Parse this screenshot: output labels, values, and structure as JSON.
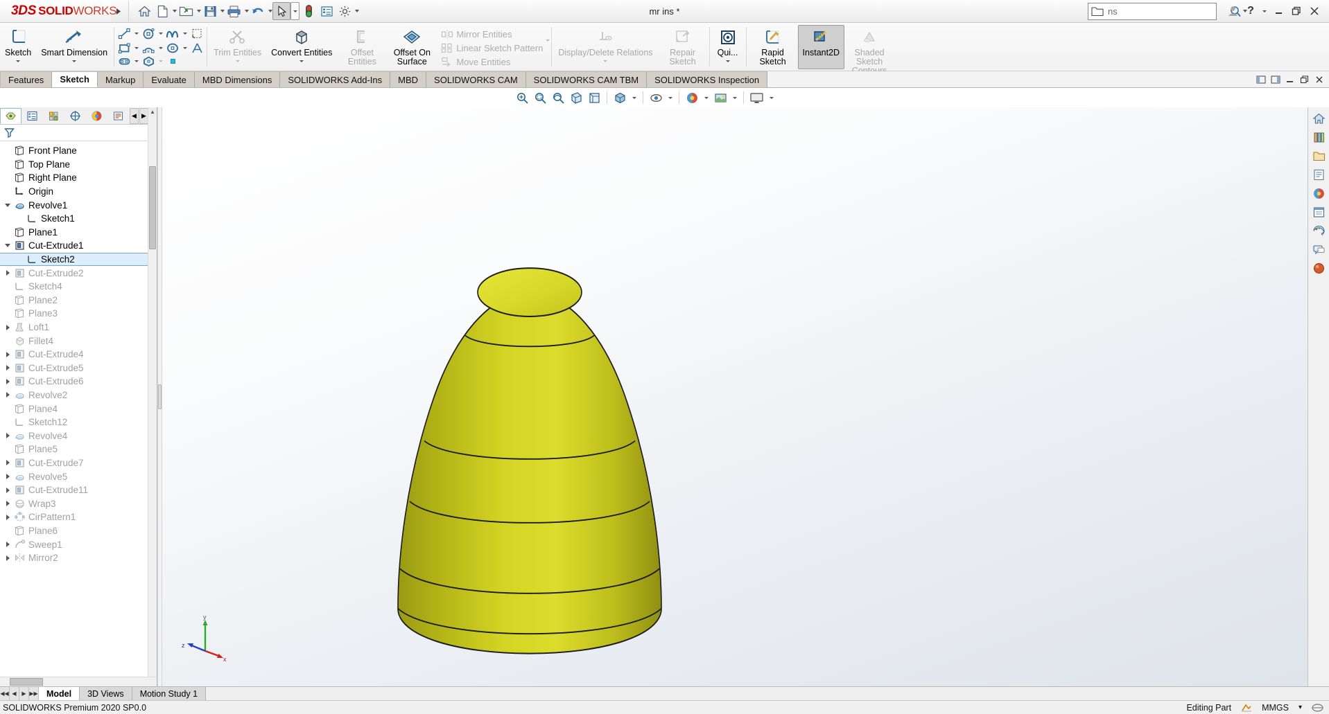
{
  "app": {
    "brand_ds": "3DS",
    "brand_solid": "SOLID",
    "brand_works": "WORKS",
    "document_title": "mr ins *",
    "search_value": "ns",
    "search_placeholder": ""
  },
  "quick_access": [
    {
      "name": "home-icon",
      "label": "Home",
      "dropdown": false
    },
    {
      "name": "new-document-icon",
      "label": "New",
      "dropdown": true
    },
    {
      "name": "open-folder-icon",
      "label": "Open",
      "dropdown": true
    },
    {
      "name": "save-icon",
      "label": "Save",
      "dropdown": true
    },
    {
      "name": "print-icon",
      "label": "Print",
      "dropdown": true
    },
    {
      "name": "undo-icon",
      "label": "Undo",
      "dropdown": true
    },
    {
      "name": "select-cursor-icon",
      "label": "Select",
      "dropdown": true
    },
    {
      "name": "rebuild-icon",
      "label": "Rebuild",
      "dropdown": false
    },
    {
      "name": "options-list-icon",
      "label": "File Properties",
      "dropdown": false
    },
    {
      "name": "gear-icon",
      "label": "Options",
      "dropdown": true
    }
  ],
  "window_controls": {
    "account": "account-icon",
    "help": "?",
    "minimize": "minimize-icon",
    "restore": "restore-icon",
    "close": "close-icon"
  },
  "ribbon": {
    "sketch_btn": "Sketch",
    "smart_dimension_btn": "Smart Dimension",
    "entity_tools": [
      {
        "name": "line-icon",
        "dropdown": true
      },
      {
        "name": "circle-icon",
        "dropdown": true
      },
      {
        "name": "spline-icon",
        "dropdown": true
      },
      {
        "name": "sketch-fillet-icon",
        "dropdown": false
      },
      {
        "name": "rectangle-icon",
        "dropdown": true
      },
      {
        "name": "arc-icon",
        "dropdown": true
      },
      {
        "name": "ellipse-icon",
        "dropdown": true
      },
      {
        "name": "text-icon",
        "dropdown": false
      },
      {
        "name": "slot-icon",
        "dropdown": true
      },
      {
        "name": "polygon-icon",
        "dropdown": false
      },
      {
        "name": "point-icon",
        "dropdown": true
      },
      {
        "name": "centerline-icon",
        "dropdown": false
      }
    ],
    "trim_entities": "Trim Entities",
    "convert_entities": "Convert Entities",
    "offset_entities": "Offset Entities",
    "offset_on_surface": "Offset On Surface",
    "mirror_entities": "Mirror Entities",
    "linear_sketch_pattern": "Linear Sketch Pattern",
    "move_entities": "Move Entities",
    "display_delete_relations": "Display/Delete Relations",
    "repair_sketch": "Repair Sketch",
    "quick_snaps": "Qui...",
    "rapid_sketch": "Rapid Sketch",
    "instant2d": "Instant2D",
    "shaded_sketch_contours": "Shaded Sketch Contours"
  },
  "command_tabs": [
    {
      "label": "Features",
      "active": false
    },
    {
      "label": "Sketch",
      "active": true
    },
    {
      "label": "Markup",
      "active": false
    },
    {
      "label": "Evaluate",
      "active": false
    },
    {
      "label": "MBD Dimensions",
      "active": false
    },
    {
      "label": "SOLIDWORKS Add-Ins",
      "active": false
    },
    {
      "label": "MBD",
      "active": false
    },
    {
      "label": "SOLIDWORKS CAM",
      "active": false
    },
    {
      "label": "SOLIDWORKS CAM TBM",
      "active": false
    },
    {
      "label": "SOLIDWORKS Inspection",
      "active": false
    }
  ],
  "view_toolbar": [
    {
      "name": "zoom-to-fit-icon",
      "dropdown": false
    },
    {
      "name": "zoom-to-area-icon",
      "dropdown": false
    },
    {
      "name": "previous-view-icon",
      "dropdown": false
    },
    {
      "name": "section-view-icon",
      "dropdown": false
    },
    {
      "name": "view-orientation-icon",
      "dropdown": false
    },
    {
      "name": "display-style-icon",
      "dropdown": true
    },
    {
      "name": "hide-show-items-icon",
      "dropdown": true
    },
    {
      "name": "edit-appearance-icon",
      "dropdown": true
    },
    {
      "name": "apply-scene-icon",
      "dropdown": true
    },
    {
      "name": "view-settings-icon",
      "dropdown": true
    }
  ],
  "tree_panel": {
    "tabs": [
      {
        "name": "feature-manager-tab",
        "selected": true
      },
      {
        "name": "property-manager-tab",
        "selected": false
      },
      {
        "name": "configuration-manager-tab",
        "selected": false
      },
      {
        "name": "dimxpert-manager-tab",
        "selected": false
      },
      {
        "name": "display-manager-tab",
        "selected": false
      },
      {
        "name": "cam-manager-tab",
        "selected": false
      }
    ],
    "filter_icon": "filter-icon",
    "items": [
      {
        "label": "Front Plane",
        "icon": "plane-icon",
        "indent": 1,
        "toggle": "none",
        "dim": false,
        "selected": false
      },
      {
        "label": "Top Plane",
        "icon": "plane-icon",
        "indent": 1,
        "toggle": "none",
        "dim": false,
        "selected": false
      },
      {
        "label": "Right Plane",
        "icon": "plane-icon",
        "indent": 1,
        "toggle": "none",
        "dim": false,
        "selected": false
      },
      {
        "label": "Origin",
        "icon": "origin-icon",
        "indent": 1,
        "toggle": "none",
        "dim": false,
        "selected": false
      },
      {
        "label": "Revolve1",
        "icon": "revolve-icon",
        "indent": 1,
        "toggle": "expanded",
        "dim": false,
        "selected": false
      },
      {
        "label": "Sketch1",
        "icon": "sketch-icon",
        "indent": 2,
        "toggle": "none",
        "dim": false,
        "selected": false
      },
      {
        "label": "Plane1",
        "icon": "plane-icon",
        "indent": 1,
        "toggle": "none",
        "dim": false,
        "selected": false
      },
      {
        "label": "Cut-Extrude1",
        "icon": "cut-extrude-icon",
        "indent": 1,
        "toggle": "expanded",
        "dim": false,
        "selected": false
      },
      {
        "label": "Sketch2",
        "icon": "sketch-icon",
        "indent": 2,
        "toggle": "none",
        "dim": false,
        "selected": true
      },
      {
        "label": "Cut-Extrude2",
        "icon": "cut-extrude-icon",
        "indent": 1,
        "toggle": "collapsed",
        "dim": true,
        "selected": false
      },
      {
        "label": "Sketch4",
        "icon": "sketch-icon",
        "indent": 1,
        "toggle": "none",
        "dim": true,
        "selected": false
      },
      {
        "label": "Plane2",
        "icon": "plane-icon",
        "indent": 1,
        "toggle": "none",
        "dim": true,
        "selected": false
      },
      {
        "label": "Plane3",
        "icon": "plane-icon",
        "indent": 1,
        "toggle": "none",
        "dim": true,
        "selected": false
      },
      {
        "label": "Loft1",
        "icon": "loft-icon",
        "indent": 1,
        "toggle": "collapsed",
        "dim": true,
        "selected": false
      },
      {
        "label": "Fillet4",
        "icon": "fillet-icon",
        "indent": 1,
        "toggle": "none",
        "dim": true,
        "selected": false
      },
      {
        "label": "Cut-Extrude4",
        "icon": "cut-extrude-icon",
        "indent": 1,
        "toggle": "collapsed",
        "dim": true,
        "selected": false
      },
      {
        "label": "Cut-Extrude5",
        "icon": "cut-extrude-icon",
        "indent": 1,
        "toggle": "collapsed",
        "dim": true,
        "selected": false
      },
      {
        "label": "Cut-Extrude6",
        "icon": "cut-extrude-icon",
        "indent": 1,
        "toggle": "collapsed",
        "dim": true,
        "selected": false
      },
      {
        "label": "Revolve2",
        "icon": "revolve-icon",
        "indent": 1,
        "toggle": "collapsed",
        "dim": true,
        "selected": false
      },
      {
        "label": "Plane4",
        "icon": "plane-icon",
        "indent": 1,
        "toggle": "none",
        "dim": true,
        "selected": false
      },
      {
        "label": "Sketch12",
        "icon": "sketch-icon",
        "indent": 1,
        "toggle": "none",
        "dim": true,
        "selected": false
      },
      {
        "label": "Revolve4",
        "icon": "revolve-icon",
        "indent": 1,
        "toggle": "collapsed",
        "dim": true,
        "selected": false
      },
      {
        "label": "Plane5",
        "icon": "plane-icon",
        "indent": 1,
        "toggle": "none",
        "dim": true,
        "selected": false
      },
      {
        "label": "Cut-Extrude7",
        "icon": "cut-extrude-icon",
        "indent": 1,
        "toggle": "collapsed",
        "dim": true,
        "selected": false
      },
      {
        "label": "Revolve5",
        "icon": "revolve-icon",
        "indent": 1,
        "toggle": "collapsed",
        "dim": true,
        "selected": false
      },
      {
        "label": "Cut-Extrude11",
        "icon": "cut-extrude-icon",
        "indent": 1,
        "toggle": "collapsed",
        "dim": true,
        "selected": false
      },
      {
        "label": "Wrap3",
        "icon": "wrap-icon",
        "indent": 1,
        "toggle": "collapsed",
        "dim": true,
        "selected": false
      },
      {
        "label": "CirPattern1",
        "icon": "cir-pattern-icon",
        "indent": 1,
        "toggle": "collapsed",
        "dim": true,
        "selected": false
      },
      {
        "label": "Plane6",
        "icon": "plane-icon",
        "indent": 1,
        "toggle": "none",
        "dim": true,
        "selected": false
      },
      {
        "label": "Sweep1",
        "icon": "sweep-icon",
        "indent": 1,
        "toggle": "collapsed",
        "dim": true,
        "selected": false
      },
      {
        "label": "Mirror2",
        "icon": "mirror-icon",
        "indent": 1,
        "toggle": "collapsed",
        "dim": true,
        "selected": false
      }
    ]
  },
  "right_rail": [
    {
      "name": "view-home-icon"
    },
    {
      "name": "appearances-icon"
    },
    {
      "name": "folder-icon"
    },
    {
      "name": "custom-properties-icon"
    },
    {
      "name": "appearance-sphere-icon"
    },
    {
      "name": "scenes-icon"
    },
    {
      "name": "lights-cameras-icon"
    },
    {
      "name": "decals-icon"
    },
    {
      "name": "view-setup-icon"
    }
  ],
  "graphics": {
    "triad": {
      "x_label": "x",
      "y_label": "y",
      "z_label": "z"
    },
    "model_color": "#c8c81e",
    "model_name": "revolved-cone-part"
  },
  "bottom_tabs": [
    {
      "label": "Model",
      "active": true
    },
    {
      "label": "3D Views",
      "active": false
    },
    {
      "label": "Motion Study 1",
      "active": false
    }
  ],
  "status_bar": {
    "version": "SOLIDWORKS Premium 2020 SP0.0",
    "mode": "Editing Part",
    "units": "MMGS",
    "units_caret": "▾"
  }
}
